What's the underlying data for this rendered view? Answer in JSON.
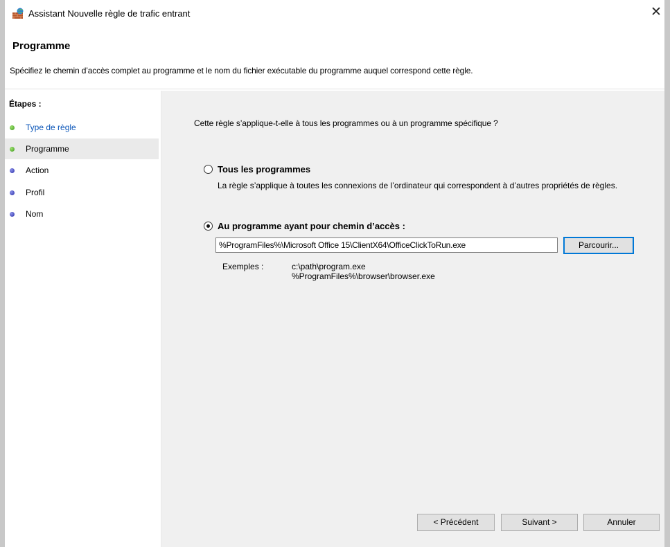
{
  "window": {
    "title": "Assistant Nouvelle règle de trafic entrant",
    "close_glyph": "✕"
  },
  "header": {
    "title": "Programme",
    "description": "Spécifiez le chemin d’accès complet au programme et le nom du fichier exécutable du programme auquel correspond cette règle."
  },
  "steps": {
    "header": "Étapes :",
    "items": [
      {
        "label": "Type de règle",
        "dot_color": "#4caf2a",
        "state": "done"
      },
      {
        "label": "Programme",
        "dot_color": "#4caf2a",
        "state": "current"
      },
      {
        "label": "Action",
        "dot_color": "#3a3fb8",
        "state": "pending"
      },
      {
        "label": "Profil",
        "dot_color": "#3a3fb8",
        "state": "pending"
      },
      {
        "label": "Nom",
        "dot_color": "#3a3fb8",
        "state": "pending"
      }
    ]
  },
  "main": {
    "question": "Cette règle s’applique-t-elle à tous les programmes ou à un programme spécifique ?",
    "option_all": {
      "label": "Tous les programmes",
      "description": "La règle s’applique à toutes les connexions de l’ordinateur qui correspondent à d’autres propriétés de règles.",
      "checked": false
    },
    "option_path": {
      "label": "Au programme ayant pour chemin d’accès :",
      "checked": true,
      "value": "%ProgramFiles%\\Microsoft Office 15\\ClientX64\\OfficeClickToRun.exe",
      "browse_label": "Parcourir..."
    },
    "examples": {
      "label": "Exemples :",
      "line1": "c:\\path\\program.exe",
      "line2": "%ProgramFiles%\\browser\\browser.exe"
    }
  },
  "footer": {
    "back_label": "< Précédent",
    "next_label": "Suivant >",
    "cancel_label": "Annuler"
  },
  "colors": {
    "accent": "#0078d7",
    "link": "#0a55b8",
    "panel_bg": "#f0f0f0"
  }
}
